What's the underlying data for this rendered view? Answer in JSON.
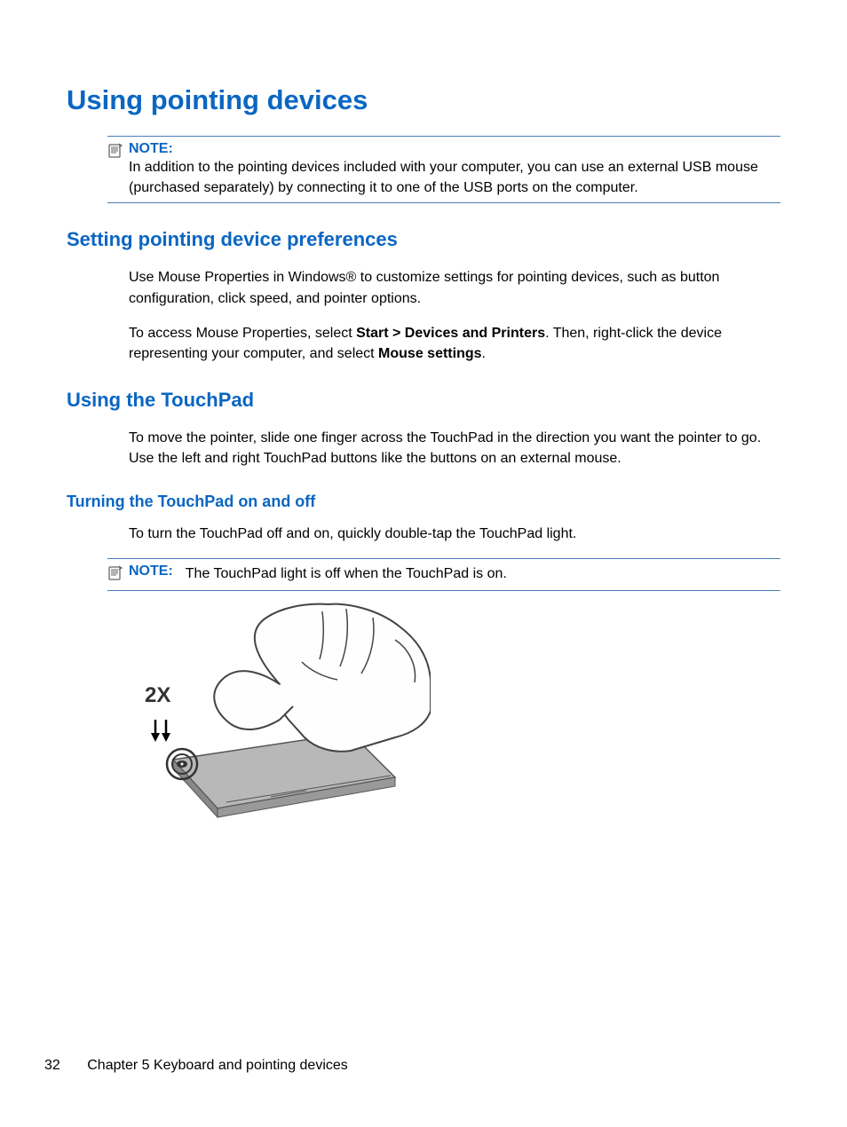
{
  "title": "Using pointing devices",
  "note1": {
    "label": "NOTE:",
    "text": "In addition to the pointing devices included with your computer, you can use an external USB mouse (purchased separately) by connecting it to one of the USB ports on the computer."
  },
  "section1": {
    "title": "Setting pointing device preferences",
    "p1": "Use Mouse Properties in Windows® to customize settings for pointing devices, such as button configuration, click speed, and pointer options.",
    "p2a": "To access Mouse Properties, select ",
    "p2b": "Start > Devices and Printers",
    "p2c": ". Then, right-click the device representing your computer, and select ",
    "p2d": "Mouse settings",
    "p2e": "."
  },
  "section2": {
    "title": "Using the TouchPad",
    "p1": "To move the pointer, slide one finger across the TouchPad in the direction you want the pointer to go. Use the left and right TouchPad buttons like the buttons on an external mouse."
  },
  "subsection1": {
    "title": "Turning the TouchPad on and off",
    "p1": "To turn the TouchPad off and on, quickly double-tap the TouchPad light."
  },
  "note2": {
    "label": "NOTE:",
    "text": "The TouchPad light is off when the TouchPad is on."
  },
  "illustration": {
    "label": "2X"
  },
  "footer": {
    "page": "32",
    "chapter": "Chapter 5   Keyboard and pointing devices"
  }
}
